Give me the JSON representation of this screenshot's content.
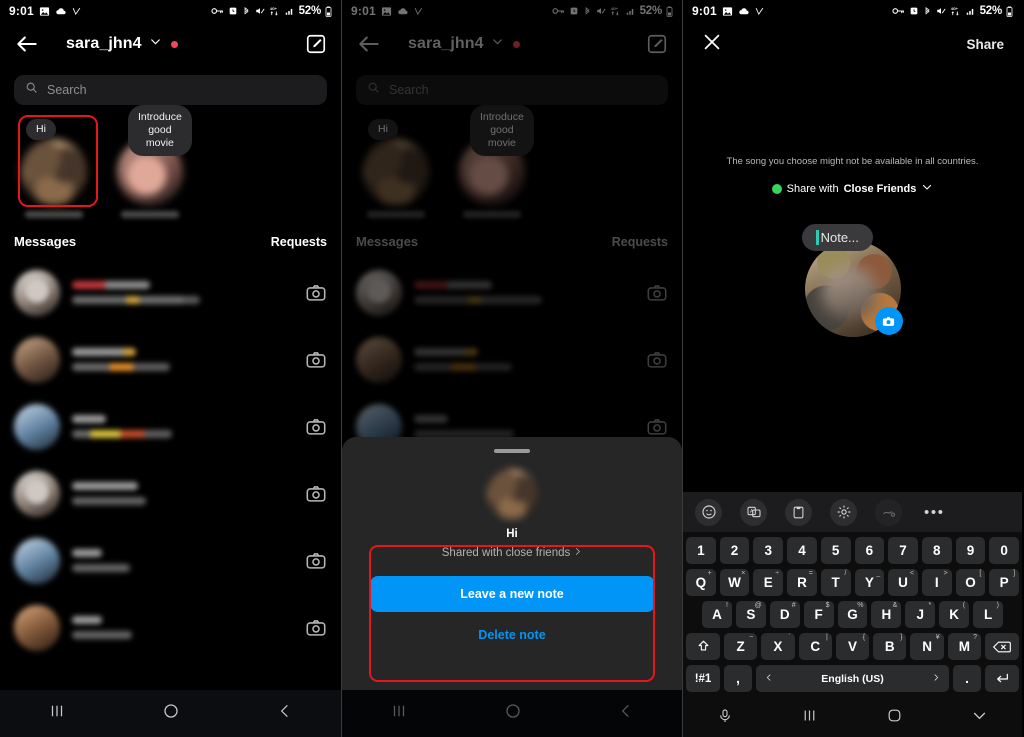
{
  "statusbar": {
    "time": "9:01",
    "battery": "52%",
    "icons_left": [
      "photo-icon",
      "cloud-icon",
      "vpn-check-icon"
    ],
    "icons_right": [
      "vpn-key-icon",
      "alarm-icon",
      "bluetooth-icon",
      "mute-icon",
      "data-transfer-icon",
      "signal-icon",
      "battery-icon"
    ]
  },
  "header": {
    "username": "sara_jhn4",
    "back_icon": "back-arrow-icon",
    "chevron_icon": "chevron-down-icon",
    "status_dot": "online-red-dot",
    "compose_icon": "compose-icon"
  },
  "search": {
    "placeholder": "Search",
    "icon": "search-icon"
  },
  "notes": {
    "items": [
      {
        "text": "Hi",
        "name_redacted": true,
        "highlighted": true
      },
      {
        "text": "Introduce good movie",
        "name_redacted": true,
        "highlighted": false
      }
    ]
  },
  "tabs": {
    "messages": "Messages",
    "requests": "Requests"
  },
  "message_rows": [
    {
      "avatar": "ava-c",
      "line1_w": 78,
      "line2_w": 112,
      "camera_icon": "camera-icon"
    },
    {
      "avatar": "ava-d",
      "line1_w": 62,
      "line2_w": 92,
      "camera_icon": "camera-icon"
    },
    {
      "avatar": "ava-e",
      "line1_w": 34,
      "line2_w": 96,
      "camera_icon": "camera-icon"
    },
    {
      "avatar": "ava-c",
      "line1_w": 66,
      "line2_w": 70,
      "camera_icon": "camera-icon"
    },
    {
      "avatar": "ava-e",
      "line1_w": 30,
      "line2_w": 56,
      "camera_icon": "camera-icon"
    },
    {
      "avatar": "ava-f",
      "line1_w": 30,
      "line2_w": 58,
      "camera_icon": "camera-icon"
    }
  ],
  "sheet": {
    "title": "Hi",
    "subtitle": "Shared with close friends",
    "subtitle_chevron": "chevron-right-icon",
    "primary_button": "Leave a new note",
    "delete_button": "Delete note",
    "grabber": "sheet-grabber"
  },
  "note_editor": {
    "close_label": "✕",
    "share_label": "Share",
    "placeholder": "Note...",
    "song_notice": "The song you choose might not be available in all countries.",
    "audience_prefix": "Share with",
    "audience_value": "Close Friends",
    "audience_chevron": "chevron-down-icon",
    "camera_badge_icon": "camera-icon"
  },
  "keyboard": {
    "toolbar_icons": [
      "emoji-icon",
      "translate-icon",
      "clipboard-icon",
      "settings-icon",
      "handwriting-icon",
      "more-icon"
    ],
    "row_numbers": [
      "1",
      "2",
      "3",
      "4",
      "5",
      "6",
      "7",
      "8",
      "9",
      "0"
    ],
    "row_top": [
      {
        "k": "Q",
        "s": "+"
      },
      {
        "k": "W",
        "s": "×"
      },
      {
        "k": "E",
        "s": "÷"
      },
      {
        "k": "R",
        "s": "="
      },
      {
        "k": "T",
        "s": "/"
      },
      {
        "k": "Y",
        "s": "_"
      },
      {
        "k": "U",
        "s": "<"
      },
      {
        "k": "I",
        "s": ">"
      },
      {
        "k": "O",
        "s": "["
      },
      {
        "k": "P",
        "s": "]"
      }
    ],
    "row_home": [
      {
        "k": "A",
        "s": "!"
      },
      {
        "k": "S",
        "s": "@"
      },
      {
        "k": "D",
        "s": "#"
      },
      {
        "k": "F",
        "s": "$"
      },
      {
        "k": "G",
        "s": "%"
      },
      {
        "k": "H",
        "s": "&"
      },
      {
        "k": "J",
        "s": "*"
      },
      {
        "k": "K",
        "s": "("
      },
      {
        "k": "L",
        "s": ")"
      }
    ],
    "row_bottom": [
      {
        "k": "Z",
        "s": "~"
      },
      {
        "k": "X",
        "s": "`"
      },
      {
        "k": "C",
        "s": "|"
      },
      {
        "k": "V",
        "s": "{"
      },
      {
        "k": "B",
        "s": "}"
      },
      {
        "k": "N",
        "s": "¥"
      },
      {
        "k": "M",
        "s": "?"
      }
    ],
    "shift_icon": "shift-icon",
    "backspace_icon": "backspace-icon",
    "symbols_key": "!#1",
    "comma_key": ",",
    "period_key": ".",
    "language": "English (US)",
    "lang_prev_icon": "chevron-left-icon",
    "lang_next_icon": "chevron-right-icon",
    "enter_icon": "enter-icon",
    "nav": [
      "mic-icon",
      "recents-icon",
      "home-icon",
      "hide-keyboard-icon"
    ]
  },
  "navbar": {
    "recents": "recents-icon",
    "home": "home-icon",
    "back": "back-icon"
  },
  "colors": {
    "accent_blue": "#0095F6",
    "highlight_red": "#e4171c",
    "close_friends_green": "#3ad35c",
    "status_red": "#ED4956",
    "caret_teal": "#33c8b4"
  }
}
